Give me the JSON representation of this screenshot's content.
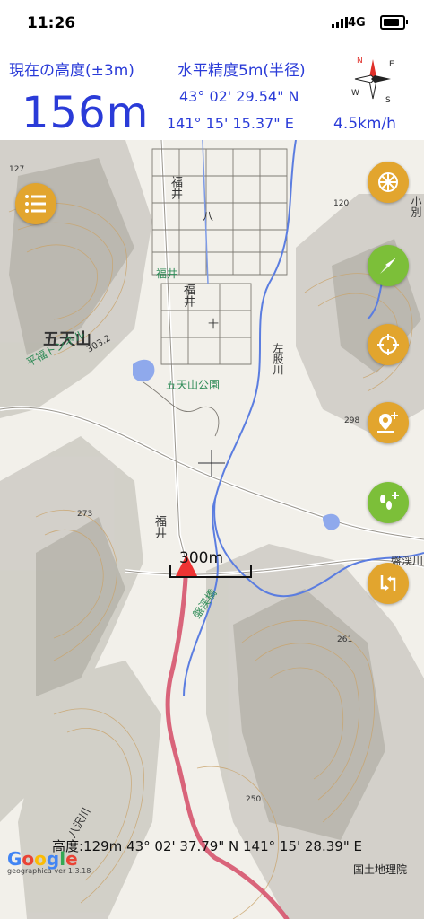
{
  "status_bar": {
    "time": "11:26",
    "network": "4G",
    "battery_level": 0.85
  },
  "hud": {
    "altitude_label": "現在の高度(±3m)",
    "altitude_value": "156m",
    "accuracy_label": "水平精度5m(半径)",
    "latitude": "43° 02' 29.54\" N",
    "longitude": "141° 15' 15.37\" E",
    "speed": "4.5km/h"
  },
  "compass": {
    "north": "N",
    "south": "S",
    "east": "E",
    "west": "W"
  },
  "map_labels": {
    "mountain": "五天山",
    "tunnel": "平福トンネル",
    "park": "五天山公園",
    "fukui1": "福井",
    "fukui_hachi": "八",
    "fukui_area": "福井",
    "fukui_juu": "十",
    "fukui2": "福井",
    "river": "左股川",
    "elev_303": "303.2",
    "elev_273": "273",
    "elev_127": "127",
    "elev_120": "120",
    "elev_298": "298",
    "elev_261": "261",
    "elev_250": "250",
    "bridge": "盤渓橋",
    "bankei": "盤渓川",
    "kobetsu": "小別",
    "hachigawa": "八沢川"
  },
  "scale": {
    "label": "300m"
  },
  "bottom": {
    "readout": "高度:129m  43° 02' 37.79\" N 141° 15' 28.39\" E",
    "google_letters": [
      {
        "ch": "G",
        "color": "#4285F4"
      },
      {
        "ch": "o",
        "color": "#EA4335"
      },
      {
        "ch": "o",
        "color": "#FBBC05"
      },
      {
        "ch": "g",
        "color": "#4285F4"
      },
      {
        "ch": "l",
        "color": "#34A853"
      },
      {
        "ch": "e",
        "color": "#EA4335"
      }
    ],
    "version": "geographica ver 1.3.18",
    "attribution": "国土地理院"
  },
  "buttons": {
    "menu": "menu-icon",
    "layers": "spiral-icon",
    "navigate": "compass-needle-icon",
    "locate": "crosshair-icon",
    "add_pin": "add-pin-icon",
    "add_footprint": "add-footprint-icon",
    "route": "route-icon"
  },
  "colors": {
    "accent_blue": "#2a3bd8",
    "fab_orange": "#e2a52e",
    "fab_green": "#7cbf39",
    "track": "#d6546e",
    "river": "#5b7de0"
  }
}
